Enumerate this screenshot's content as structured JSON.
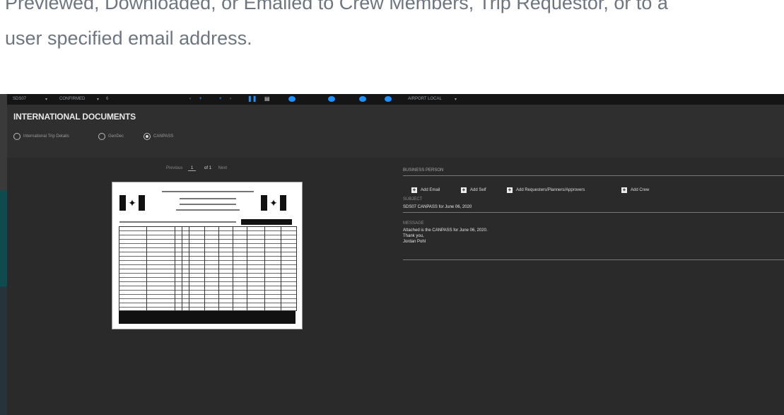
{
  "intro": {
    "line1": "Previewed, Downloaded, or Emailed to Crew Members, Trip Requestor, or to a",
    "line2": "user specified email address."
  },
  "topbar": {
    "trip": "SDS07",
    "status": "CONFIRMED",
    "leg": "6",
    "nav_prev": "‹",
    "nav_next": "›",
    "time_mode": "AIRPORT LOCAL"
  },
  "header": {
    "title": "INTERNATIONAL DOCUMENTS",
    "options": [
      {
        "label": "International Trip Details",
        "selected": false
      },
      {
        "label": "GenDec",
        "selected": false
      },
      {
        "label": "CANPASS",
        "selected": true
      }
    ]
  },
  "pager": {
    "previous": "Previous",
    "page": "1",
    "of": "of 1",
    "next": "Next"
  },
  "email": {
    "recipient_label": "BUSINESS PERSON",
    "actions": [
      "Add Email",
      "Add Self",
      "Add Requesters/Planners/Approvers",
      "Add Crew"
    ],
    "subject_label": "SUBJECT",
    "subject": "SDS07 CANPASS for June 06, 2020",
    "message_label": "MESSAGE",
    "message_lines": [
      "Attached is the CANPASS for June 06, 2020.",
      "Thank you,",
      "Jordan Pohl"
    ]
  },
  "colors": {
    "accent": "#1e90ff",
    "panel": "#2a2a2a",
    "header": "#2f2f2f"
  }
}
